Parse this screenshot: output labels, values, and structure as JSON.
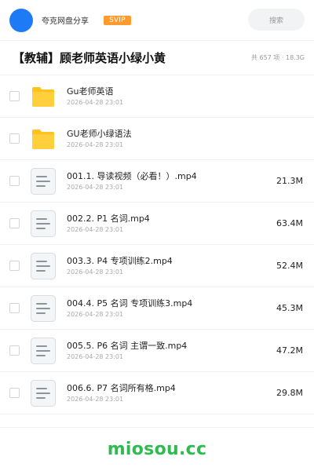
{
  "header": {
    "site_name": "夸克网盘分享",
    "badge": "SVIP",
    "search_placeholder": "搜索"
  },
  "share": {
    "title": "【教辅】顾老师英语小绿小黄",
    "meta": "共 657 项 · 18.3G"
  },
  "files": [
    {
      "name": "Gu老师英语",
      "date": "2026-04-28 23:01",
      "size": "",
      "type": "folder"
    },
    {
      "name": "GU老师小绿语法",
      "date": "2026-04-28 23:01",
      "size": "",
      "type": "folder"
    },
    {
      "name": "001.1. 导读视频（必看！）.mp4",
      "date": "2026-04-28 23:01",
      "size": "21.3M",
      "type": "file"
    },
    {
      "name": "002.2. P1 名词.mp4",
      "date": "2026-04-28 23:01",
      "size": "63.4M",
      "type": "file"
    },
    {
      "name": "003.3. P4 专项训练2.mp4",
      "date": "2026-04-28 23:01",
      "size": "52.4M",
      "type": "file"
    },
    {
      "name": "004.4. P5 名词 专项训练3.mp4",
      "date": "2026-04-28 23:01",
      "size": "45.3M",
      "type": "file"
    },
    {
      "name": "005.5. P6 名词 主谓一致.mp4",
      "date": "2026-04-28 23:01",
      "size": "47.2M",
      "type": "file"
    },
    {
      "name": "006.6. P7 名词所有格.mp4",
      "date": "2026-04-28 23:01",
      "size": "29.8M",
      "type": "file"
    }
  ],
  "footer": {
    "watermark": "miosou.cc"
  },
  "colors": {
    "avatar": "#1f7bf5",
    "badge": "#ff9a2e",
    "folder": "#ffc21a",
    "watermark": "#2fbb4f"
  },
  "icons": {
    "folder": "folder-icon",
    "file": "document-icon"
  }
}
